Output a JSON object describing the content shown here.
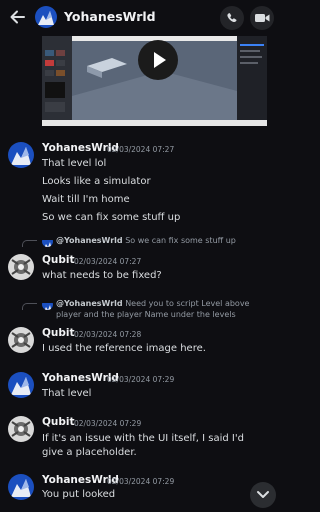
{
  "header": {
    "title": "YohanesWrld",
    "chevron": "›",
    "back_icon": "arrow-left-icon",
    "call_icon": "phone-icon",
    "video_icon": "video-camera-icon"
  },
  "messages": [
    {
      "author": "YohanesWrld",
      "time": "02/03/2024 07:27",
      "lines": [
        "That level lol",
        "Looks like a simulator",
        "Wait till I'm home",
        "So we can fix some stuff up"
      ]
    },
    {
      "reply": {
        "author": "@YohanesWrld",
        "text": "So we can fix some stuff up"
      },
      "author": "Qubit",
      "time": "02/03/2024 07:27",
      "lines": [
        "what needs to be fixed?"
      ]
    },
    {
      "reply": {
        "author": "@YohanesWrld",
        "text": "Need you to script Level above player and the player Name under the levels"
      },
      "author": "Qubit",
      "time": "02/03/2024 07:28",
      "lines": [
        "I used the reference image here."
      ]
    },
    {
      "author": "YohanesWrld",
      "time": "02/03/2024 07:29",
      "lines": [
        "That level"
      ]
    },
    {
      "author": "Qubit",
      "time": "02/03/2024 07:29",
      "lines": [
        "If it's an issue with the UI itself, I said I'd give a placeholder."
      ]
    },
    {
      "author": "YohanesWrld",
      "time": "02/03/2024 07:29",
      "lines": [
        "You put looked"
      ]
    }
  ],
  "icons": {
    "play": "play-icon",
    "scroll_down": "chevron-down-icon"
  },
  "colors": {
    "background": "#0e0e12",
    "avatar_blue": "#2456c7",
    "play_button": "#1b1b1b"
  }
}
